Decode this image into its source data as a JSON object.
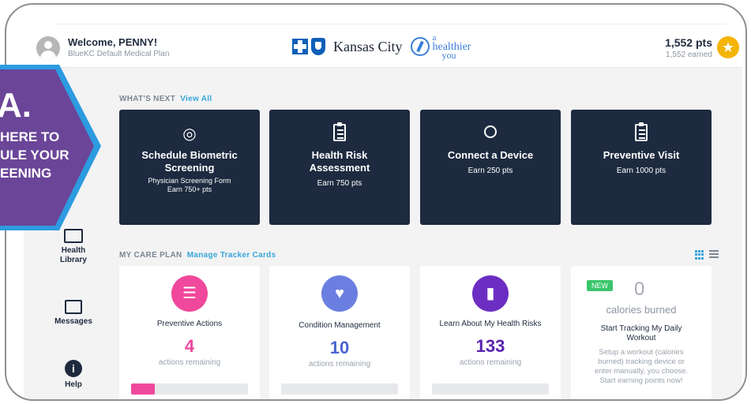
{
  "header": {
    "welcome": "Welcome, PENNY!",
    "plan": "BlueKC Default Medical Plan",
    "brand_name": "Kansas City",
    "tagline_a": "a",
    "tagline_healthier": "healthier",
    "tagline_you": "you",
    "points": "1,552 pts",
    "earned": "1,552 earned"
  },
  "callout": {
    "letter": "A.",
    "line1": "HERE TO",
    "line2": "ULE YOUR",
    "line3": "EENING",
    "color": "#6b4598",
    "border_color": "#2d9be0"
  },
  "whats_next": {
    "label": "WHAT'S NEXT",
    "link": "View All",
    "cards": [
      {
        "title_line1": "Schedule Biometric",
        "title_line2": "Screening",
        "sub1": "Physician Screening Form",
        "sub2": "Earn 750+ pts",
        "icon": "fingerprint-icon"
      },
      {
        "title_line1": "Health Risk",
        "title_line2": "Assessment",
        "sub1": "Earn 750 pts",
        "icon": "clipboard-icon"
      },
      {
        "title_line1": "Connect a Device",
        "sub1": "Earn 250 pts",
        "icon": "watch-icon"
      },
      {
        "title_line1": "Preventive Visit",
        "sub1": "Earn 1000 pts",
        "icon": "clipboard-icon"
      }
    ]
  },
  "sidebar": {
    "items": [
      {
        "label_line1": "Health",
        "label_line2": "Library",
        "icon": "book-icon"
      },
      {
        "label_line1": "Messages",
        "icon": "inbox-icon"
      },
      {
        "label_line1": "Help",
        "icon": "info-icon"
      }
    ]
  },
  "care_plan": {
    "label": "MY CARE PLAN",
    "link": "Manage Tracker Cards",
    "cards": [
      {
        "title": "Preventive Actions",
        "count": "4",
        "remaining": "actions remaining",
        "color": "#f0489c",
        "progress": 0.2
      },
      {
        "title": "Condition Management",
        "count": "10",
        "remaining": "actions remaining",
        "color": "#6b7fe0",
        "progress": 0
      },
      {
        "title": "Learn About My Health Risks",
        "count": "133",
        "remaining": "actions remaining",
        "color": "#6c2ec2",
        "progress": 0
      }
    ],
    "workout": {
      "badge": "NEW",
      "value": "0",
      "unit": "calories burned",
      "title_line1": "Start Tracking My Daily",
      "title_line2": "Workout",
      "desc_line1": "Setup a workout (calories",
      "desc_line2": "burned) tracking device or",
      "desc_line3": "enter manually, you choose.",
      "desc_line4": "Start earning points now!"
    }
  },
  "colors": {
    "card_dark": "#1d2a3f",
    "accent_link": "#38a6d8",
    "star": "#f4b400"
  }
}
